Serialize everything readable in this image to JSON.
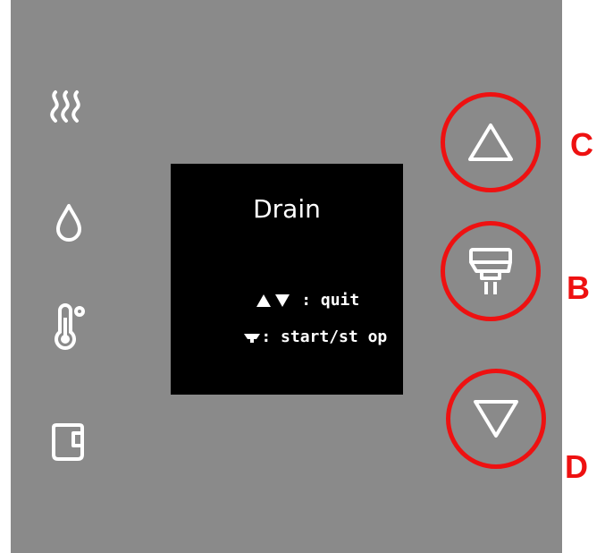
{
  "panel": {
    "icons": [
      "steam-icon",
      "water-drop-icon",
      "thermometer-icon",
      "water-tank-icon"
    ],
    "background": "#8a8a8a"
  },
  "display": {
    "title": "Drain",
    "quit_text": " : quit",
    "start_stop_text": ": start/st op"
  },
  "buttons": {
    "up": {
      "name": "up-arrow-button",
      "icon": "triangle-up-icon"
    },
    "drain": {
      "name": "drain-button",
      "icon": "drain-icon"
    },
    "down": {
      "name": "down-arrow-button",
      "icon": "triangle-down-icon"
    }
  },
  "annotations": {
    "up_label": "C",
    "drain_label": "B",
    "down_label": "D",
    "circle_color": "#ee1111"
  }
}
